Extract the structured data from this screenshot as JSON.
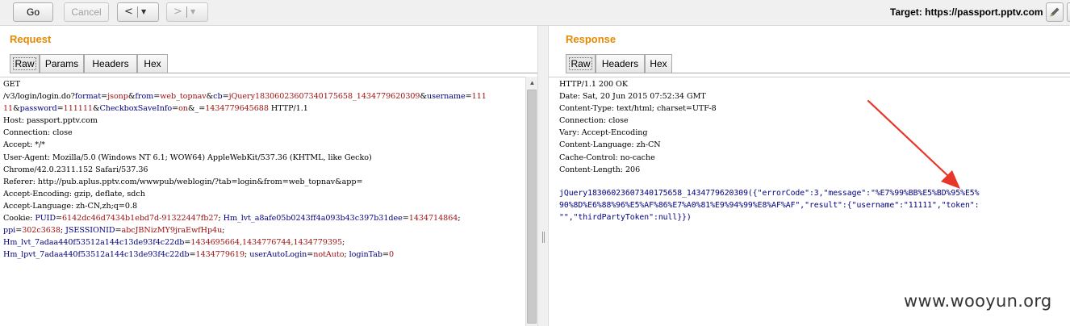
{
  "toolbar": {
    "go_label": "Go",
    "cancel_label": "Cancel",
    "back_arrow": "<",
    "forward_arrow": ">",
    "dropdown_glyph": "▼",
    "target_label": "Target: https://passport.pptv.com",
    "edit_icon": "pencil-icon",
    "help_icon": "help-icon"
  },
  "request": {
    "title": "Request",
    "tabs": [
      "Raw",
      "Params",
      "Headers",
      "Hex"
    ],
    "active_tab": "Raw",
    "lines": [
      [
        {
          "t": "GET",
          "c": "o"
        }
      ],
      [
        {
          "t": "/v3/login/login.do?",
          "c": "o"
        },
        {
          "t": "format",
          "c": "k"
        },
        {
          "t": "=",
          "c": "o"
        },
        {
          "t": "jsonp",
          "c": "v"
        },
        {
          "t": "&",
          "c": "o"
        },
        {
          "t": "from",
          "c": "k"
        },
        {
          "t": "=",
          "c": "o"
        },
        {
          "t": "web_topnav",
          "c": "v"
        },
        {
          "t": "&",
          "c": "o"
        },
        {
          "t": "cb",
          "c": "k"
        },
        {
          "t": "=",
          "c": "o"
        },
        {
          "t": "jQuery18306023607340175658_1434779620309",
          "c": "v"
        },
        {
          "t": "&",
          "c": "o"
        },
        {
          "t": "username",
          "c": "k"
        },
        {
          "t": "=",
          "c": "o"
        },
        {
          "t": "111",
          "c": "v"
        }
      ],
      [
        {
          "t": "11",
          "c": "v"
        },
        {
          "t": "&",
          "c": "o"
        },
        {
          "t": "password",
          "c": "k"
        },
        {
          "t": "=",
          "c": "o"
        },
        {
          "t": "111111",
          "c": "v"
        },
        {
          "t": "&",
          "c": "o"
        },
        {
          "t": "CheckboxSaveInfo",
          "c": "k"
        },
        {
          "t": "=",
          "c": "o"
        },
        {
          "t": "on",
          "c": "v"
        },
        {
          "t": "&",
          "c": "o"
        },
        {
          "t": "_",
          "c": "k"
        },
        {
          "t": "=",
          "c": "o"
        },
        {
          "t": "1434779645688",
          "c": "v"
        },
        {
          "t": " HTTP/1.1",
          "c": "o"
        }
      ],
      [
        {
          "t": "Host: passport.pptv.com",
          "c": "o"
        }
      ],
      [
        {
          "t": "Connection: close",
          "c": "o"
        }
      ],
      [
        {
          "t": "Accept: */*",
          "c": "o"
        }
      ],
      [
        {
          "t": "User-Agent: Mozilla/5.0 (Windows NT 6.1; WOW64) AppleWebKit/537.36 (KHTML, like Gecko)",
          "c": "o"
        }
      ],
      [
        {
          "t": "Chrome/42.0.2311.152 Safari/537.36",
          "c": "o"
        }
      ],
      [
        {
          "t": "Referer: http://pub.aplus.pptv.com/wwwpub/weblogin/?tab=login&from=web_topnav&app=",
          "c": "o"
        }
      ],
      [
        {
          "t": "Accept-Encoding: gzip, deflate, sdch",
          "c": "o"
        }
      ],
      [
        {
          "t": "Accept-Language: zh-CN,zh;q=0.8",
          "c": "o"
        }
      ],
      [
        {
          "t": "Cookie: ",
          "c": "o"
        },
        {
          "t": "PUID",
          "c": "k"
        },
        {
          "t": "=",
          "c": "o"
        },
        {
          "t": "6142dc46d7434b1ebd7d-91322447fb27",
          "c": "v"
        },
        {
          "t": "; ",
          "c": "o"
        },
        {
          "t": "Hm_lvt_a8afe05b0243ff4a093b43c397b31dee",
          "c": "k"
        },
        {
          "t": "=",
          "c": "o"
        },
        {
          "t": "1434714864",
          "c": "v"
        },
        {
          "t": ";",
          "c": "o"
        }
      ],
      [
        {
          "t": "ppi",
          "c": "k"
        },
        {
          "t": "=",
          "c": "o"
        },
        {
          "t": "302c3638",
          "c": "v"
        },
        {
          "t": "; ",
          "c": "o"
        },
        {
          "t": "JSESSIONID",
          "c": "k"
        },
        {
          "t": "=",
          "c": "o"
        },
        {
          "t": "abcJBNizMY9jraEwfHp4u",
          "c": "v"
        },
        {
          "t": ";",
          "c": "o"
        }
      ],
      [
        {
          "t": "Hm_lvt_7adaa440f53512a144c13de93f4c22db",
          "c": "k"
        },
        {
          "t": "=",
          "c": "o"
        },
        {
          "t": "1434695664,1434776744,1434779395",
          "c": "v"
        },
        {
          "t": ";",
          "c": "o"
        }
      ],
      [
        {
          "t": "Hm_lpvt_7adaa440f53512a144c13de93f4c22db",
          "c": "k"
        },
        {
          "t": "=",
          "c": "o"
        },
        {
          "t": "1434779619",
          "c": "v"
        },
        {
          "t": "; ",
          "c": "o"
        },
        {
          "t": "userAutoLogin",
          "c": "k"
        },
        {
          "t": "=",
          "c": "o"
        },
        {
          "t": "notAuto",
          "c": "v"
        },
        {
          "t": "; ",
          "c": "o"
        },
        {
          "t": "loginTab",
          "c": "k"
        },
        {
          "t": "=",
          "c": "o"
        },
        {
          "t": "0",
          "c": "v"
        }
      ]
    ]
  },
  "response": {
    "title": "Response",
    "tabs": [
      "Raw",
      "Headers",
      "Hex"
    ],
    "active_tab": "Raw",
    "headers": [
      "HTTP/1.1 200 OK",
      "Date: Sat, 20 Jun 2015 07:52:34 GMT",
      "Content-Type: text/html; charset=UTF-8",
      "Connection: close",
      "Vary: Accept-Encoding",
      "Content-Language: zh-CN",
      "Cache-Control: no-cache",
      "Content-Length: 206"
    ],
    "body_lines": [
      "jQuery18306023607340175658_1434779620309({\"errorCode\":3,\"message\":\"%E7%99%BB%E5%BD%95%E5%",
      "90%8D%E6%88%96%E5%AF%86%E7%A0%81%E9%94%99%E8%AF%AF\",\"result\":{\"username\":\"11111\",\"token\":",
      "\"\",\"thirdPartyToken\":null}})"
    ]
  },
  "annotation": {
    "arrow_color": "#e8362b",
    "watermark": "www.wooyun.org"
  },
  "colors": {
    "param_name": "#000080",
    "param_value": "#a01010",
    "panel_title": "#e58a00"
  }
}
